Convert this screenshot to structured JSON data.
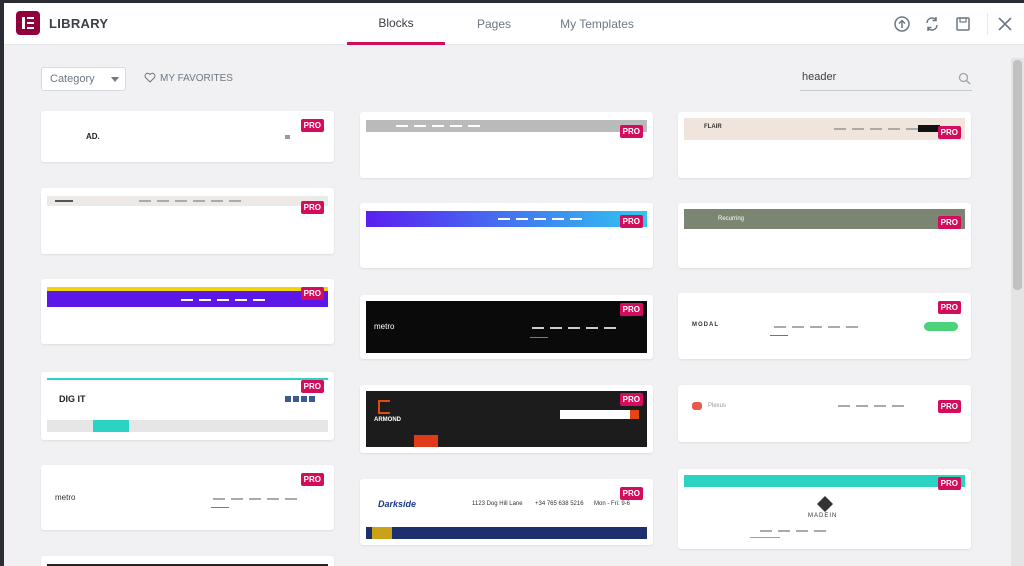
{
  "header": {
    "title": "LIBRARY",
    "tabs": [
      {
        "label": "Blocks",
        "active": true
      },
      {
        "label": "Pages",
        "active": false
      },
      {
        "label": "My Templates",
        "active": false
      }
    ],
    "icons": [
      "upload-icon",
      "sync-icon",
      "save-icon",
      "close-icon"
    ]
  },
  "toolbar": {
    "category_label": "Category",
    "favorites_label": "MY FAVORITES",
    "search_value": "header"
  },
  "badge": {
    "pro_label": "PRO"
  },
  "templates": {
    "ad": {
      "brand": "AD."
    },
    "metro1": {
      "brand": "metro"
    },
    "metro2": {
      "brand": "metro",
      "menu": [
        "Home",
        "Shop",
        "Services",
        "Contact",
        "About"
      ]
    },
    "digit": {
      "brand": "DIG IT",
      "menu": [
        "HOME",
        "SHOP",
        "SERVICES",
        "ABOUT",
        "BLOG",
        "SUPPORT",
        "CONTACT"
      ]
    },
    "modal": {
      "brand": "MODAL",
      "cta": "CONNECT NOW",
      "menu": [
        "HOME",
        "BLOG",
        "SERVICES",
        "CONTACT",
        "ABOUT"
      ]
    },
    "armond": {
      "brand": "ARMOND",
      "menu": [
        "Home",
        "Shop",
        "Services",
        "About",
        "Blog",
        "Support",
        "Contact"
      ]
    },
    "darkside": {
      "brand": "Darkside",
      "contact1": "1123 Dog Hill Lane",
      "contact2": "+34 765 638 5216",
      "contact3": "Mon - Fri: 9-6"
    },
    "madein": {
      "brand": "MADEIN",
      "menu": [
        "Home",
        "Blog",
        "Services",
        "Contact"
      ]
    },
    "plexus": {
      "brand": "Plexus"
    },
    "recurring": {
      "brand": "Recurring"
    },
    "flair": {
      "brand": "FLAIR"
    }
  },
  "colors": {
    "accent": "#d30c5c",
    "logo": "#92003b",
    "text": "#3a3f45",
    "muted": "#6d7882"
  }
}
